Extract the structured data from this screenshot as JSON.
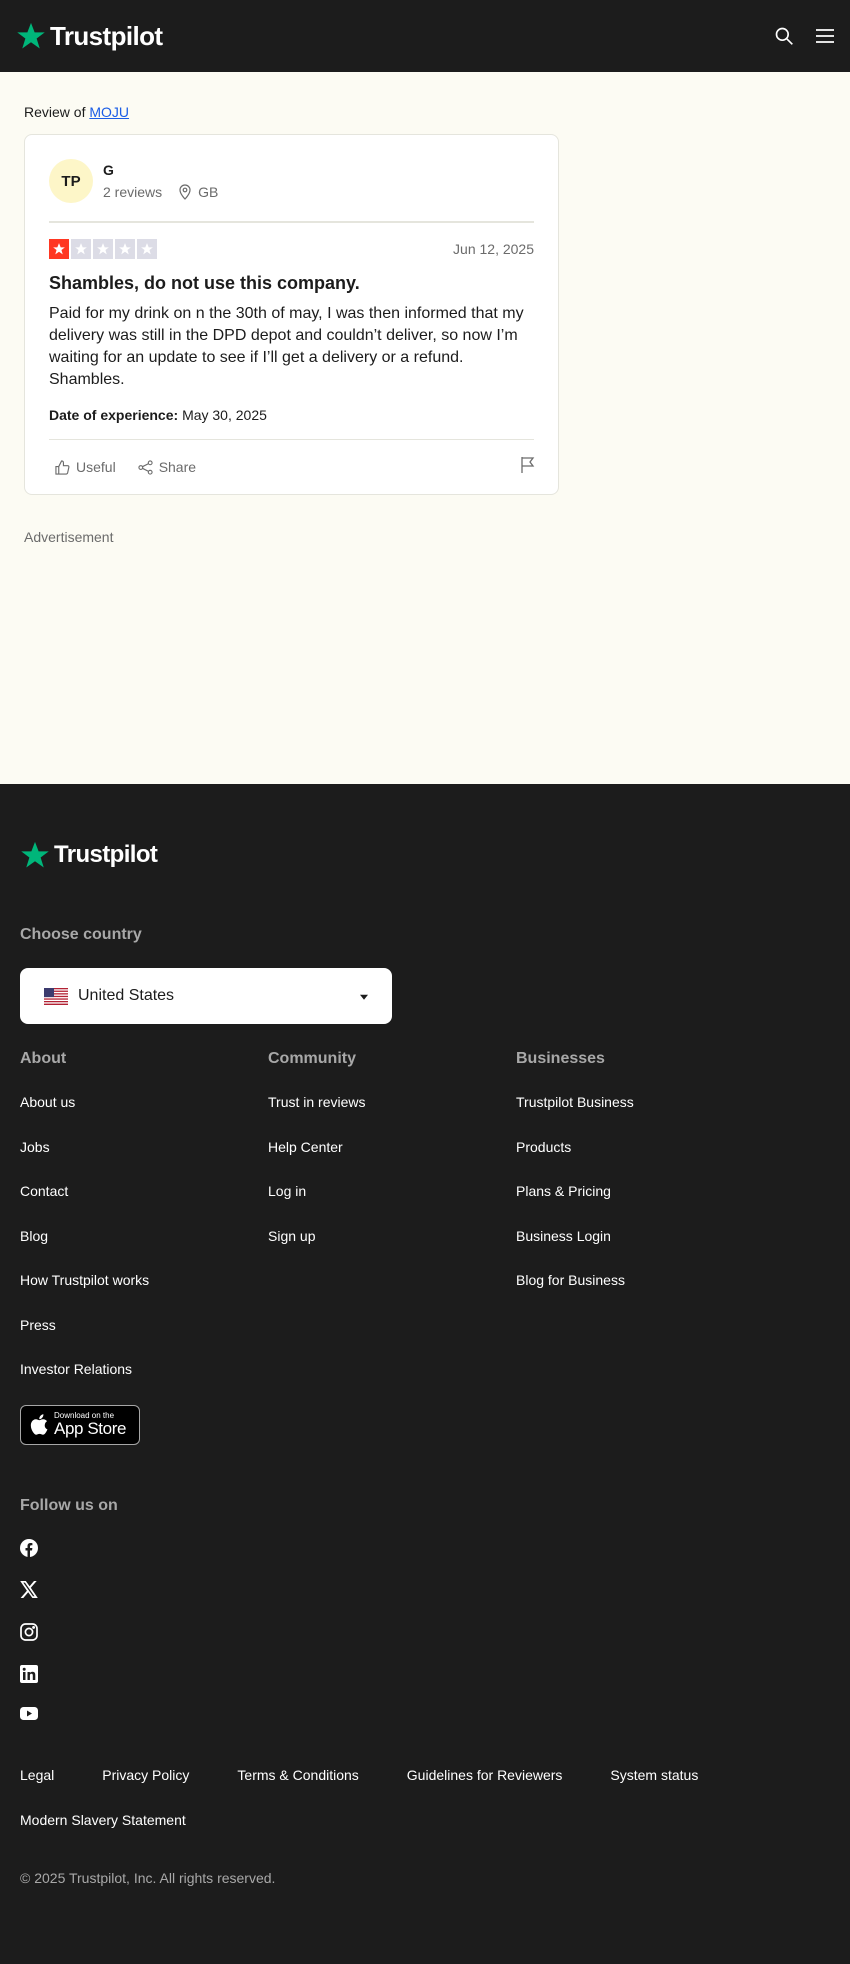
{
  "header": {
    "logo_text": "Trustpilot"
  },
  "review_of": {
    "prefix": "Review of",
    "company": "MOJU"
  },
  "review": {
    "avatar_initials": "TP",
    "author": "G",
    "review_count": "2 reviews",
    "location": "GB",
    "rating": 1,
    "rating_max": 5,
    "date": "Jun 12, 2025",
    "title": "Shambles, do not use this company.",
    "body": "Paid for my drink on n the 30th of may, I was then informed that my delivery was still in the DPD depot and couldn’t deliver, so now I’m waiting for an update to see if I’ll get a delivery or a refund. Shambles.",
    "experience_label": "Date of experience:",
    "experience_date": "May 30, 2025",
    "useful_label": "Useful",
    "share_label": "Share"
  },
  "ad_label": "Advertisement",
  "footer": {
    "logo_text": "Trustpilot",
    "choose_country": "Choose country",
    "country": "United States",
    "about": {
      "heading": "About",
      "links": [
        "About us",
        "Jobs",
        "Contact",
        "Blog",
        "How Trustpilot works",
        "Press",
        "Investor Relations"
      ]
    },
    "community": {
      "heading": "Community",
      "links": [
        "Trust in reviews",
        "Help Center",
        "Log in",
        "Sign up"
      ]
    },
    "businesses": {
      "heading": "Businesses",
      "links": [
        "Trustpilot Business",
        "Products",
        "Plans & Pricing",
        "Business Login",
        "Blog for Business"
      ]
    },
    "appstore_small": "Download on the",
    "appstore_big": "App Store",
    "follow": "Follow us on",
    "legal_links": [
      "Legal",
      "Privacy Policy",
      "Terms & Conditions",
      "Guidelines for Reviewers",
      "System status",
      "Modern Slavery Statement"
    ],
    "copyright": "© 2025 Trustpilot, Inc. All rights reserved."
  },
  "colors": {
    "brand_green": "#00b67a",
    "star_red": "#ff3722",
    "dark": "#1c1c1c",
    "link_blue": "#1a5ce6"
  }
}
